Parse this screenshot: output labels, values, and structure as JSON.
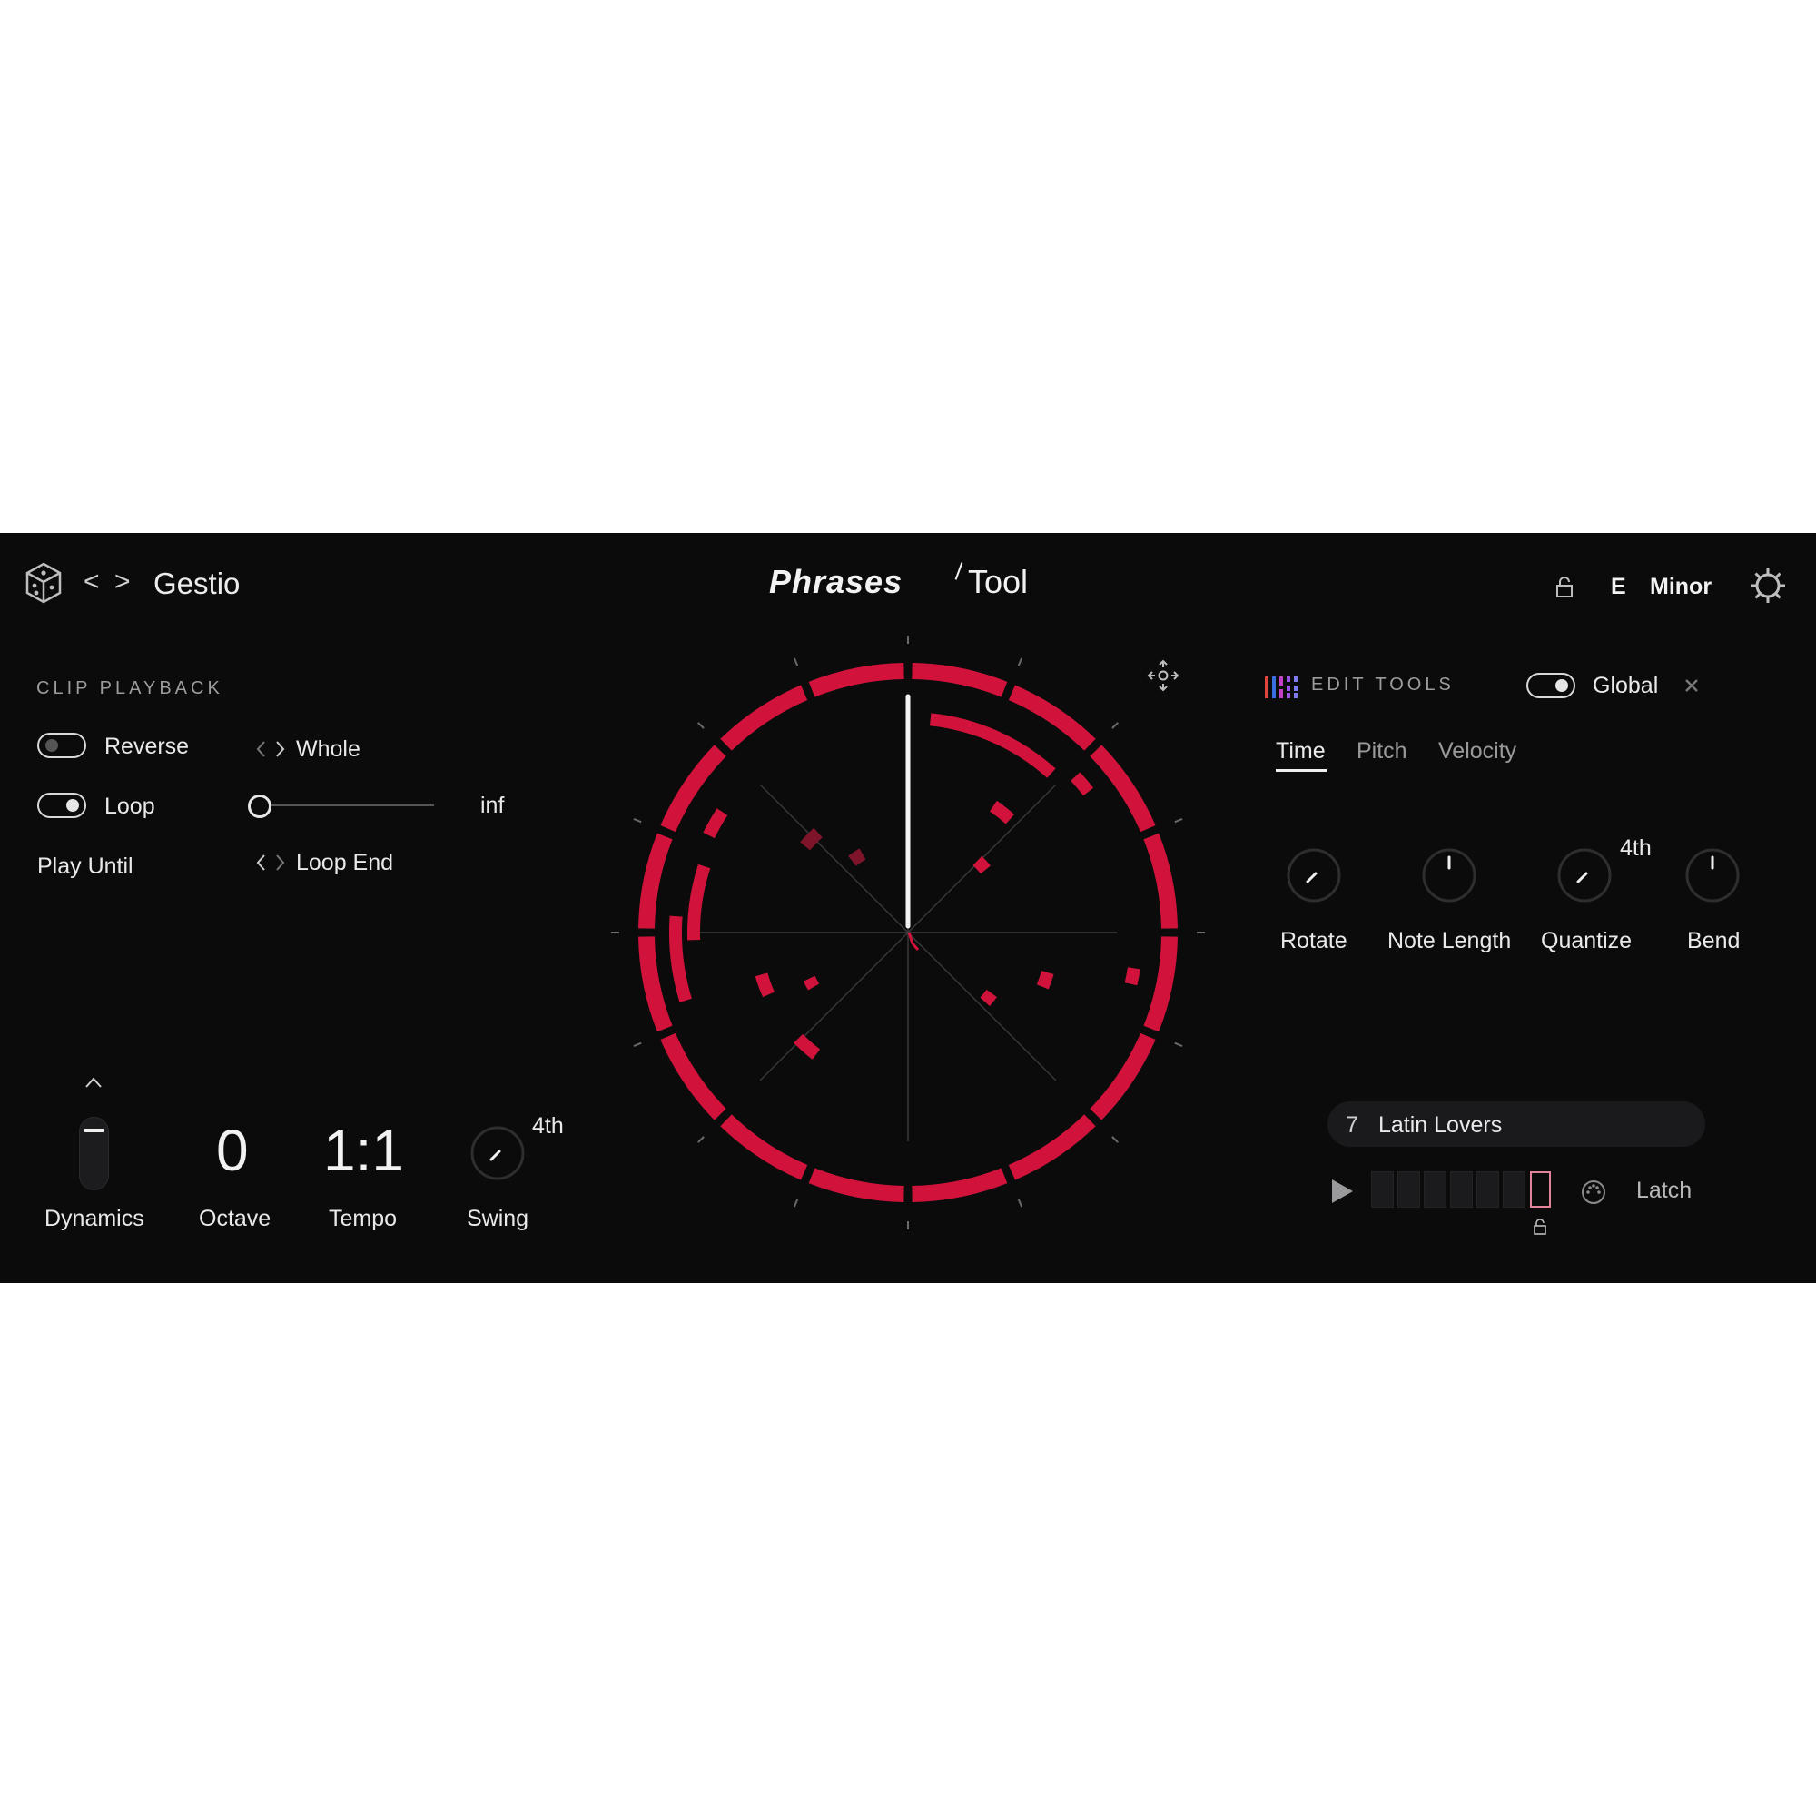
{
  "header": {
    "nav_prev": "<",
    "nav_next": ">",
    "preset_name": "Gestio",
    "logo_primary": "Phrases",
    "logo_secondary": "Tool",
    "key_root": "E",
    "key_scale": "Minor"
  },
  "clip_playback": {
    "heading": "CLIP PLAYBACK",
    "reverse_label": "Reverse",
    "reverse_on": false,
    "loop_label": "Loop",
    "loop_on": true,
    "play_until_label": "Play Until",
    "range_value": "Whole",
    "slider_end_label": "inf",
    "loop_end_value": "Loop End"
  },
  "performance": {
    "dynamics_label": "Dynamics",
    "octave_value": "0",
    "octave_label": "Octave",
    "tempo_value": "1:1",
    "tempo_label": "Tempo",
    "swing_value": "4th",
    "swing_label": "Swing"
  },
  "edit_tools": {
    "heading": "EDIT TOOLS",
    "global_label": "Global",
    "global_on": true,
    "tabs": [
      {
        "label": "Time",
        "active": true
      },
      {
        "label": "Pitch",
        "active": false
      },
      {
        "label": "Velocity",
        "active": false
      }
    ],
    "knobs": [
      {
        "label": "Rotate",
        "value_text": ""
      },
      {
        "label": "Note Length",
        "value_text": ""
      },
      {
        "label": "Quantize",
        "value_text": "4th"
      },
      {
        "label": "Bend",
        "value_text": ""
      }
    ]
  },
  "phrase": {
    "number": "7",
    "name": "Latin Lovers",
    "latch_label": "Latch"
  },
  "colors": {
    "accent": "#d1133c",
    "accent_dim": "#7d1429",
    "background": "#0b0b0c",
    "text": "#e8e8e8"
  },
  "icons": [
    "dice-icon",
    "chevron-left-icon",
    "chevron-right-icon",
    "lock-icon",
    "gear-icon",
    "move-icon",
    "edit-tools-icon",
    "close-icon",
    "play-icon",
    "midi-icon",
    "chevron-up-icon"
  ]
}
